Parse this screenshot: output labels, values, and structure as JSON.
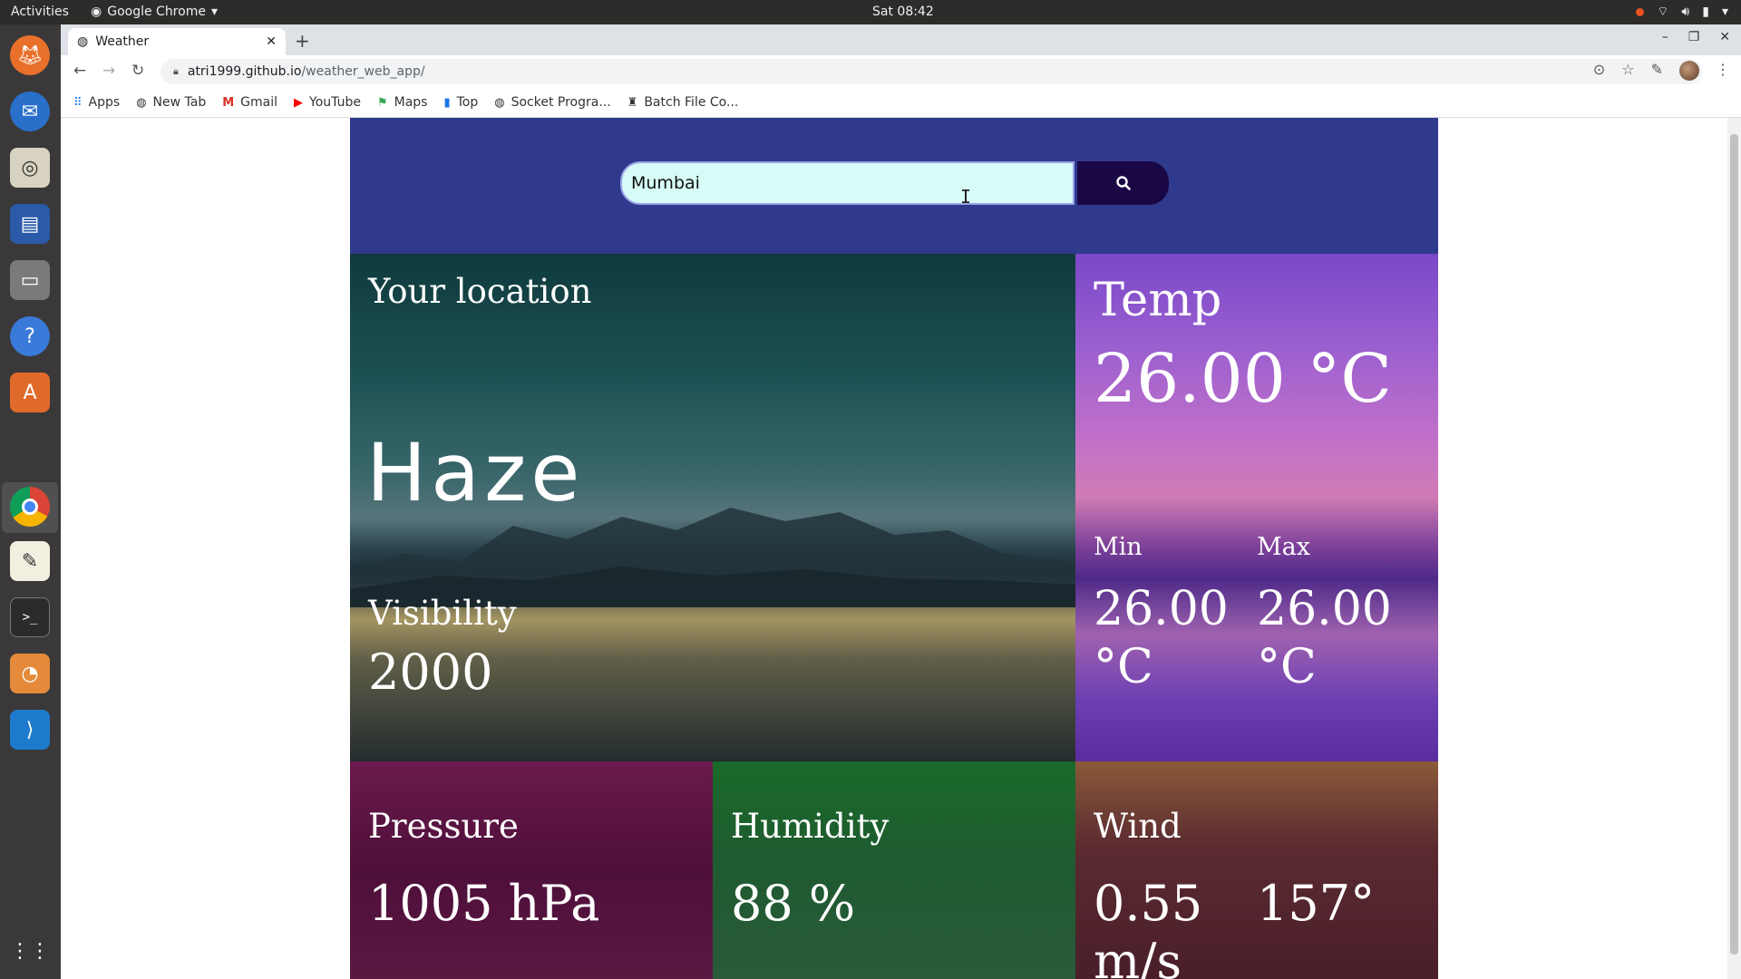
{
  "system": {
    "activities": "Activities",
    "app_name": "Google Chrome",
    "clock": "Sat 08:42"
  },
  "browser": {
    "tab_title": "Weather",
    "url_host": "atri1999.github.io",
    "url_path": "/weather_web_app/",
    "bookmarks": [
      {
        "label": "Apps",
        "icon": "apps-grid-icon"
      },
      {
        "label": "New Tab",
        "icon": "globe-icon"
      },
      {
        "label": "Gmail",
        "icon": "gmail-icon"
      },
      {
        "label": "YouTube",
        "icon": "youtube-icon"
      },
      {
        "label": "Maps",
        "icon": "maps-icon"
      },
      {
        "label": "Top",
        "icon": "bar-chart-icon"
      },
      {
        "label": "Socket Progra...",
        "icon": "globe-icon"
      },
      {
        "label": "Batch File Co...",
        "icon": "bookmark-icon"
      }
    ]
  },
  "weather": {
    "search": {
      "value": "Mumbai"
    },
    "location_label": "Your location",
    "condition": "Haze",
    "visibility": {
      "label": "Visibility",
      "value": "2000"
    },
    "temp": {
      "label": "Temp",
      "value": "26.00 °C"
    },
    "min": {
      "label": "Min",
      "value": "26.00 °C"
    },
    "max": {
      "label": "Max",
      "value": "26.00 °C"
    },
    "pressure": {
      "label": "Pressure",
      "value": "1005 hPa"
    },
    "humidity": {
      "label": "Humidity",
      "value": "88 %"
    },
    "wind": {
      "label": "Wind",
      "speed": "0.55 m/s",
      "direction": "157°"
    }
  },
  "colors": {
    "header_bg": "#303a8c",
    "search_bg": "#d7fbf6",
    "search_button": "#190746"
  }
}
